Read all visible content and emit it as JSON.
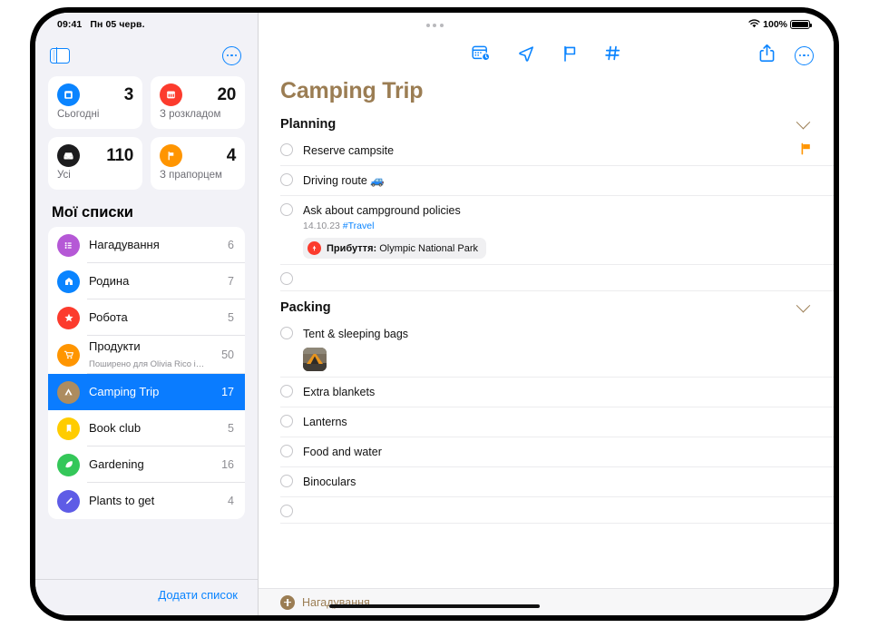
{
  "status_bar": {
    "time": "09:41",
    "date": "Пн 05 черв.",
    "wifi_icon": "wifi-icon",
    "battery_percent": "100%"
  },
  "sidebar": {
    "toggle_icon": "sidebar-toggle-icon",
    "more_icon": "ellipsis-circle-icon",
    "smart_cards": [
      {
        "id": "today",
        "icon": "calendar-day-icon",
        "glyph": "▣",
        "color": "#0a84ff",
        "count": "3",
        "label": "Сьогодні"
      },
      {
        "id": "scheduled",
        "icon": "calendar-icon",
        "glyph": "▤",
        "color": "#fc3b2d",
        "count": "20",
        "label": "З розкладом"
      },
      {
        "id": "all",
        "icon": "tray-icon",
        "glyph": "▼",
        "color": "#1c1c1e",
        "count": "110",
        "label": "Усі"
      },
      {
        "id": "flagged",
        "icon": "flag-icon",
        "glyph": "⚑",
        "color": "#ff9500",
        "count": "4",
        "label": "З прапорцем"
      }
    ],
    "my_lists_header": "Мої списки",
    "lists": [
      {
        "name": "Нагадування",
        "count": "6",
        "icon": "list-bullet-icon",
        "glyph": "☰",
        "color": "#b558d6",
        "sub": ""
      },
      {
        "name": "Родина",
        "count": "7",
        "icon": "house-icon",
        "glyph": "⌂",
        "color": "#0a84ff",
        "sub": ""
      },
      {
        "name": "Робота",
        "count": "5",
        "icon": "star-icon",
        "glyph": "★",
        "color": "#fc3b2d",
        "sub": ""
      },
      {
        "name": "Продукти",
        "count": "50",
        "icon": "cart-icon",
        "glyph": "🛒",
        "color": "#ff9500",
        "sub": "Поширено для Olivia Rico i…"
      },
      {
        "name": "Camping Trip",
        "count": "17",
        "icon": "tent-icon",
        "glyph": "⛺",
        "color": "#ad8c5f",
        "sub": "",
        "selected": true
      },
      {
        "name": "Book club",
        "count": "5",
        "icon": "bookmark-icon",
        "glyph": "🔖",
        "color": "#ffcc00",
        "sub": ""
      },
      {
        "name": "Gardening",
        "count": "16",
        "icon": "leaf-icon",
        "glyph": "🍃",
        "color": "#34c759",
        "sub": ""
      },
      {
        "name": "Plants to get",
        "count": "4",
        "icon": "pencil-icon",
        "glyph": "✐",
        "color": "#5e5ce6",
        "sub": ""
      }
    ],
    "add_list_label": "Додати список"
  },
  "detail": {
    "toolbar": {
      "date_icon": "calendar-badge-clock-icon",
      "location_icon": "location-arrow-icon",
      "flag_icon": "flag-outline-icon",
      "tag_icon": "hashtag-icon",
      "share_icon": "share-icon",
      "more_icon": "ellipsis-circle-icon"
    },
    "title": "Camping Trip",
    "title_color": "#9b7d53",
    "sections": [
      {
        "title": "Planning",
        "collapse_icon": "chevron-down-icon",
        "reminders": [
          {
            "title": "Reserve campsite",
            "flagged": true
          },
          {
            "title": "Driving route 🚙"
          },
          {
            "title": "Ask about campground policies",
            "meta_date": "14.10.23",
            "meta_tag": "#Travel",
            "location_badge": {
              "icon": "location-pin-icon",
              "prefix": "Прибуття:",
              "place": "Olympic National Park"
            }
          },
          {
            "title": "",
            "empty": true
          }
        ]
      },
      {
        "title": "Packing",
        "collapse_icon": "chevron-down-icon",
        "reminders": [
          {
            "title": "Tent & sleeping bags",
            "attachment": "tent-photo-thumbnail"
          },
          {
            "title": "Extra blankets"
          },
          {
            "title": "Lanterns"
          },
          {
            "title": "Food and water"
          },
          {
            "title": "Binoculars"
          },
          {
            "title": "",
            "empty": true
          }
        ]
      }
    ],
    "add_reminder_label": "Нагадування",
    "add_icon": "plus-circle-icon"
  }
}
